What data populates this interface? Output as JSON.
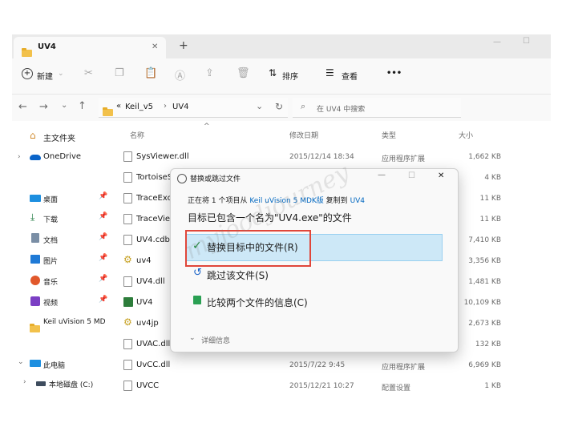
{
  "window": {
    "tab_title": "UV4",
    "tab_close": "✕",
    "new_tab": "+",
    "minimize": "—",
    "maximize": "☐"
  },
  "toolbar": {
    "new_label": "新建",
    "sort_label": "排序",
    "view_label": "查看",
    "more": "•••"
  },
  "address": {
    "overflow": "«",
    "crumb1": "Keil_v5",
    "sep": "›",
    "crumb2": "UV4",
    "search_placeholder": "在 UV4 中搜索"
  },
  "sidebar": {
    "home": "主文件夹",
    "onedrive": "OneDrive",
    "desktop": "桌面",
    "downloads": "下载",
    "documents": "文档",
    "pictures": "图片",
    "music": "音乐",
    "videos": "视频",
    "keil": "Keil uVision 5 MD",
    "thispc": "此电脑",
    "localdisk": "本地磁盘 (C:)"
  },
  "columns": {
    "name": "名称",
    "date": "修改日期",
    "type": "类型",
    "size": "大小"
  },
  "files": [
    {
      "name": "SysViewer.dll",
      "date": "2015/12/14 18:34",
      "type": "应用程序扩展",
      "size": "1,662 KB"
    },
    {
      "name": "TortoiseS",
      "date": "",
      "type": "",
      "size": "4 KB"
    },
    {
      "name": "TraceExc",
      "date": "",
      "type": "",
      "size": "11 KB"
    },
    {
      "name": "TraceView",
      "date": "",
      "type": "",
      "size": "11 KB"
    },
    {
      "name": "UV4.cdb",
      "date": "",
      "type": "",
      "size": "7,410 KB"
    },
    {
      "name": "uv4",
      "date": "",
      "type": "",
      "size": "3,356 KB"
    },
    {
      "name": "UV4.dll",
      "date": "",
      "type": "",
      "size": "1,481 KB"
    },
    {
      "name": "UV4",
      "date": "",
      "type": "",
      "size": "10,109 KB"
    },
    {
      "name": "uv4jp",
      "date": "",
      "type": "",
      "size": "2,673 KB"
    },
    {
      "name": "UVAC.dll",
      "date": "",
      "type": "",
      "size": "132 KB"
    },
    {
      "name": "UvCC.dll",
      "date": "2015/7/22 9:45",
      "type": "应用程序扩展",
      "size": "6,969 KB"
    },
    {
      "name": "UVCC",
      "date": "2015/12/21 10:27",
      "type": "配置设置",
      "size": "1 KB"
    }
  ],
  "dialog": {
    "title": "替换或跳过文件",
    "info_prefix": "正在将 1 个项目从",
    "info_src": "Keil uVision 5 MDK版",
    "info_mid": "复制到",
    "info_dst": "UV4",
    "heading": "目标已包含一个名为\"UV4.exe\"的文件",
    "opt_replace": "替换目标中的文件(R)",
    "opt_skip": "跳过该文件(S)",
    "opt_compare": "比较两个文件的信息(C)",
    "details": "详细信息",
    "minimize": "—",
    "maximize": "☐",
    "close": "✕"
  },
  "watermark": "myjoodjourney",
  "colors": {
    "accent_link": "#0067c0",
    "selection": "#cde8f7",
    "highlight_box": "#e0463a"
  }
}
